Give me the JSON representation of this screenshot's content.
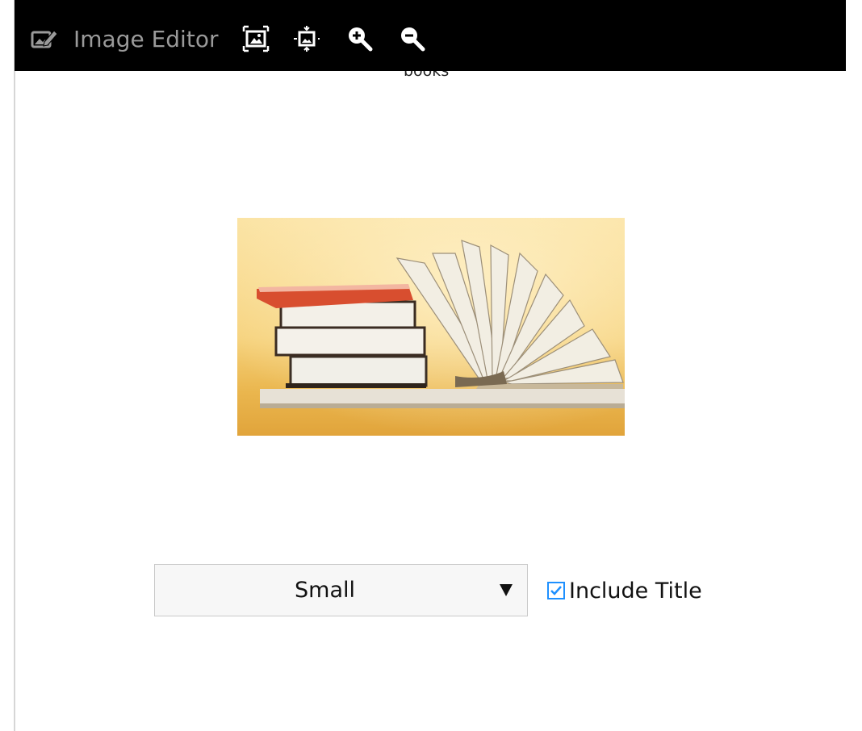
{
  "app": {
    "title": "Image Editor",
    "icon": "image-edit-icon"
  },
  "toolbar": {
    "buttons": [
      {
        "name": "fit-to-window-icon"
      },
      {
        "name": "actual-size-icon"
      },
      {
        "name": "zoom-in-icon"
      },
      {
        "name": "zoom-out-icon"
      }
    ]
  },
  "image": {
    "caption": "books",
    "subject": "stack of books and open book on shelf"
  },
  "size_select": {
    "value": "Small"
  },
  "include_title": {
    "label": "Include Title",
    "checked": true
  },
  "colors": {
    "toolbar_bg": "#000000",
    "title_text": "#9a9a9a",
    "checkbox_accent": "#1e90ff"
  }
}
